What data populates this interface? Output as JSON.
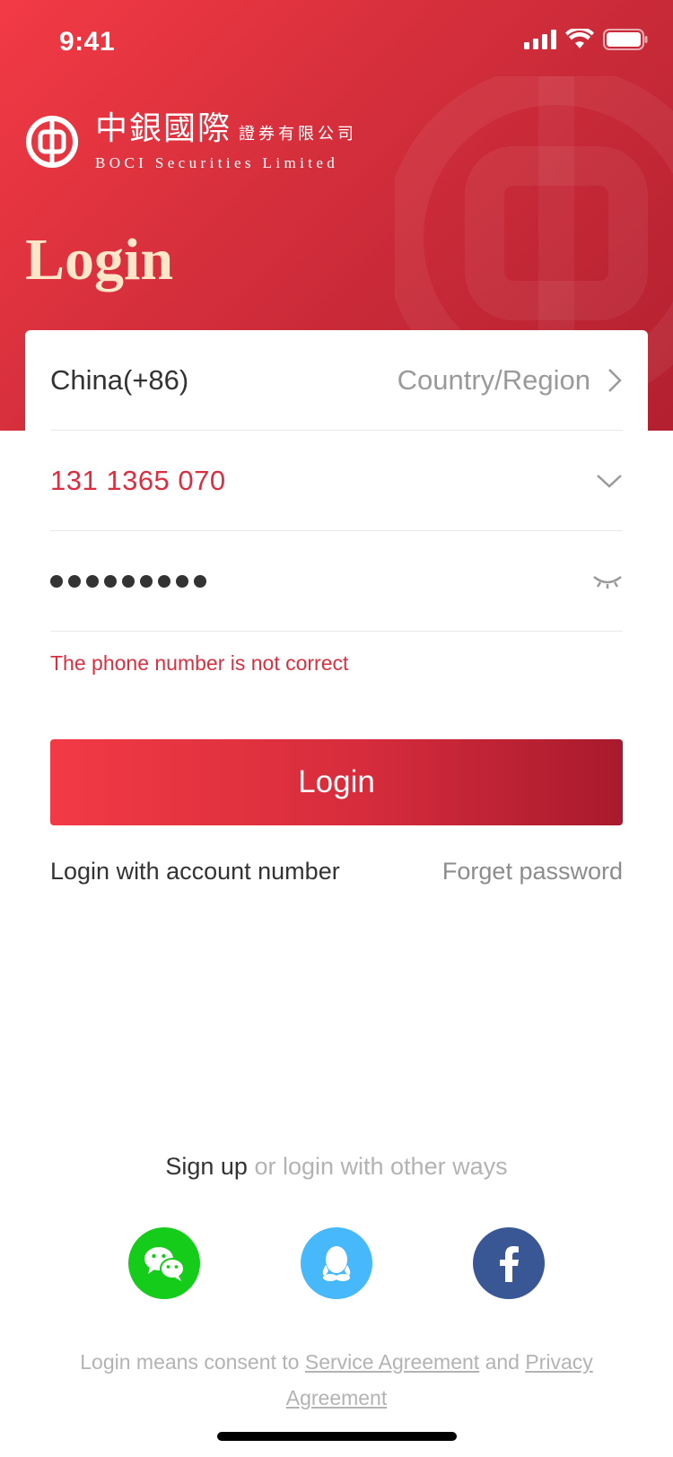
{
  "status_bar": {
    "time": "9:41"
  },
  "brand": {
    "cn_name": "中銀國際",
    "cn_suffix": "證券有限公司",
    "en_name": "BOCI Securities Limited"
  },
  "header": {
    "title": "Login"
  },
  "form": {
    "country_value": "China(+86)",
    "country_label": "Country/Region",
    "phone_value": "131 1365 070",
    "password_masked_count": 9,
    "error_message": "The phone number is not correct"
  },
  "login_button": {
    "label": "Login"
  },
  "links": {
    "account_login": "Login with account number",
    "forget_password": "Forget password"
  },
  "signup": {
    "strong": "Sign up",
    "soft": "or login with other ways"
  },
  "socials": [
    {
      "name": "wechat",
      "icon": "wechat-icon",
      "color": "#15cc1a"
    },
    {
      "name": "qq",
      "icon": "qq-icon",
      "color": "#47b8f9"
    },
    {
      "name": "facebook",
      "icon": "facebook-icon",
      "color": "#3a5795"
    }
  ],
  "consent": {
    "prefix": "Login means consent to",
    "service": "Service Agreement",
    "middle": "and",
    "privacy": "Privacy Agreement"
  },
  "colors": {
    "accent": "#f23a45",
    "accent_dark": "#a81a2d",
    "title_gold": "#ffe6c8",
    "error": "#d83040"
  }
}
